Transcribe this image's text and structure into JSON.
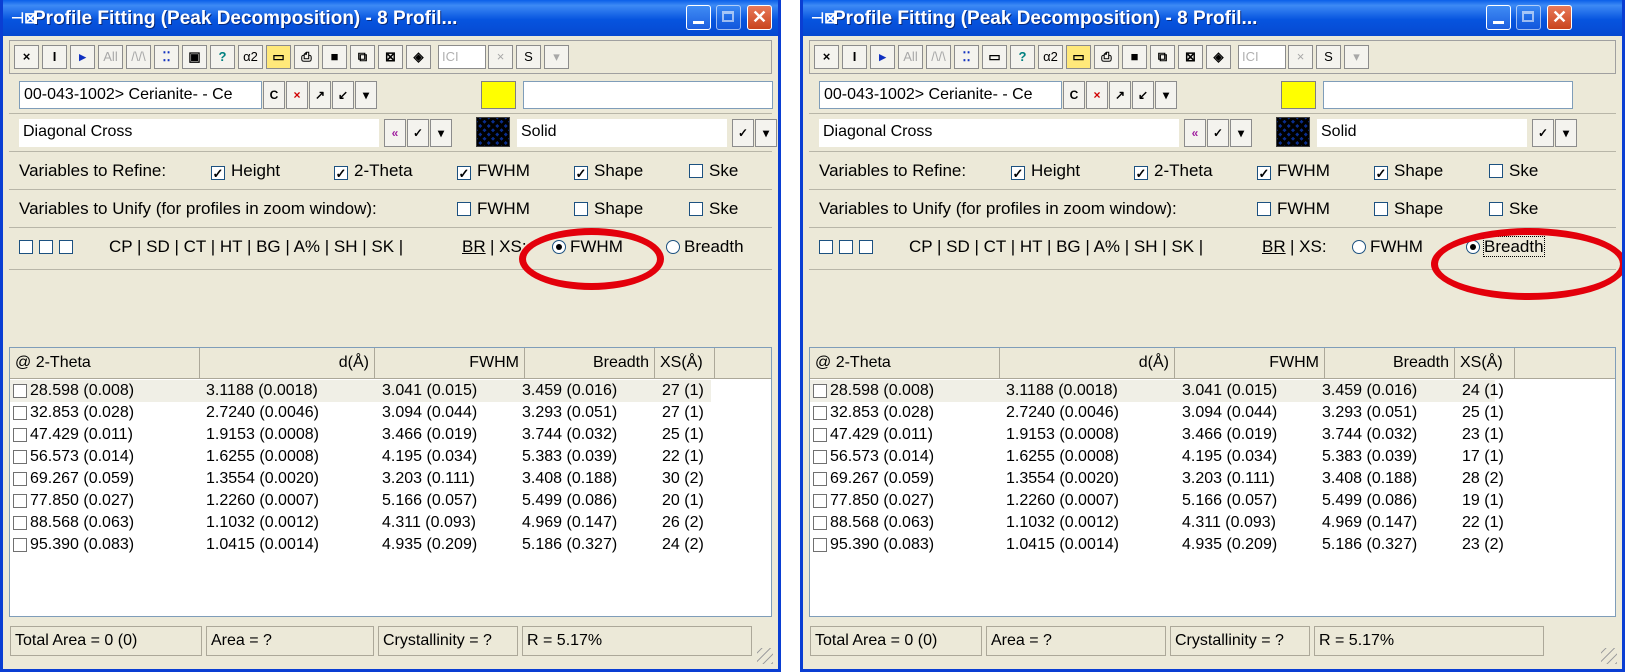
{
  "windows": [
    {
      "title": "Profile Fitting (Peak Decomposition) - 8 Profil...",
      "toolbar": {
        "close": "×",
        "i": "I",
        "play": "▸",
        "all": "All",
        "peaks": "/\\/\\",
        "dots": "⁚⁚",
        "box": "▣",
        "help": "?",
        "alpha": "α2",
        "folder": "▭",
        "print": "⎙",
        "save": "■",
        "copy": "⧉",
        "export": "⊠",
        "gem": "◈",
        "input": "ICI",
        "x": "×",
        "s": "S",
        "dd": "▾"
      },
      "phase": {
        "value": "00-043-1002> Cerianite- - Ce",
        "btn_c": "C",
        "btn_x": "×",
        "btn_up": "↗",
        "btn_down": "↙",
        "dd": "▾",
        "text2": ""
      },
      "pattern": {
        "value": "Diagonal Cross",
        "line": "Solid"
      },
      "refine": {
        "label": "Variables to Refine:",
        "items": [
          "Height",
          "2-Theta",
          "FWHM",
          "Shape",
          "Ske"
        ],
        "checked": [
          true,
          true,
          true,
          true,
          false
        ]
      },
      "unify": {
        "label": "Variables to Unify (for profiles in zoom window):",
        "items": [
          "FWHM",
          "Shape",
          "Ske"
        ],
        "checked": [
          false,
          false,
          false
        ]
      },
      "options": {
        "codes": "CP | SD | CT | HT | BG | A% | SH | SK |",
        "br": "BR",
        "xs_label": "| XS:",
        "fwhm": "FWHM",
        "breadth": "Breadth",
        "selected": "fwhm"
      },
      "table": {
        "headers": [
          "@ 2-Theta",
          "d(Å)",
          "FWHM",
          "Breadth",
          "XS(Å)"
        ],
        "rows": [
          [
            "28.598 (0.008)",
            "3.1188 (0.0018)",
            "3.041 (0.015)",
            "3.459 (0.016)",
            "27 (1)"
          ],
          [
            "32.853 (0.028)",
            "2.7240 (0.0046)",
            "3.094 (0.044)",
            "3.293 (0.051)",
            "27 (1)"
          ],
          [
            "47.429 (0.011)",
            "1.9153 (0.0008)",
            "3.466 (0.019)",
            "3.744 (0.032)",
            "25 (1)"
          ],
          [
            "56.573 (0.014)",
            "1.6255 (0.0008)",
            "4.195 (0.034)",
            "5.383 (0.039)",
            "22 (1)"
          ],
          [
            "69.267 (0.059)",
            "1.3554 (0.0020)",
            "3.203 (0.111)",
            "3.408 (0.188)",
            "30 (2)"
          ],
          [
            "77.850 (0.027)",
            "1.2260 (0.0007)",
            "5.166 (0.057)",
            "5.499 (0.086)",
            "20 (1)"
          ],
          [
            "88.568 (0.063)",
            "1.1032 (0.0012)",
            "4.311 (0.093)",
            "4.969 (0.147)",
            "26 (2)"
          ],
          [
            "95.390 (0.083)",
            "1.0415 (0.0014)",
            "4.935 (0.209)",
            "5.186 (0.327)",
            "24 (2)"
          ]
        ]
      },
      "status": {
        "total": "Total Area = 0 (0)",
        "area": "Area = ?",
        "cryst": "Crystallinity = ?",
        "r": "R = 5.17%"
      }
    },
    {
      "title": "Profile Fitting (Peak Decomposition) - 8 Profil...",
      "toolbar": {
        "close": "×",
        "i": "I",
        "play": "▸",
        "all": "All",
        "peaks": "/\\/\\",
        "dots": "⁚⁚",
        "box": "▭",
        "help": "?",
        "alpha": "α2",
        "folder": "▭",
        "print": "⎙",
        "save": "■",
        "copy": "⧉",
        "export": "⊠",
        "gem": "◈",
        "input": "ICI",
        "x": "×",
        "s": "S",
        "dd": "▾"
      },
      "phase": {
        "value": "00-043-1002> Cerianite- - Ce",
        "btn_c": "C",
        "btn_x": "×",
        "btn_up": "↗",
        "btn_down": "↙",
        "dd": "▾",
        "text2": ""
      },
      "pattern": {
        "value": "Diagonal Cross",
        "line": "Solid"
      },
      "refine": {
        "label": "Variables to Refine:",
        "items": [
          "Height",
          "2-Theta",
          "FWHM",
          "Shape",
          "Ske"
        ],
        "checked": [
          true,
          true,
          true,
          true,
          false
        ]
      },
      "unify": {
        "label": "Variables to Unify (for profiles in zoom window):",
        "items": [
          "FWHM",
          "Shape",
          "Ske"
        ],
        "checked": [
          false,
          false,
          false
        ]
      },
      "options": {
        "codes": "CP | SD | CT | HT | BG | A% | SH | SK |",
        "br": "BR",
        "xs_label": "| XS:",
        "fwhm": "FWHM",
        "breadth": "Breadth",
        "selected": "breadth"
      },
      "table": {
        "headers": [
          "@ 2-Theta",
          "d(Å)",
          "FWHM",
          "Breadth",
          "XS(Å)"
        ],
        "rows": [
          [
            "28.598 (0.008)",
            "3.1188 (0.0018)",
            "3.041 (0.015)",
            "3.459 (0.016)",
            "24 (1)"
          ],
          [
            "32.853 (0.028)",
            "2.7240 (0.0046)",
            "3.094 (0.044)",
            "3.293 (0.051)",
            "25 (1)"
          ],
          [
            "47.429 (0.011)",
            "1.9153 (0.0008)",
            "3.466 (0.019)",
            "3.744 (0.032)",
            "23 (1)"
          ],
          [
            "56.573 (0.014)",
            "1.6255 (0.0008)",
            "4.195 (0.034)",
            "5.383 (0.039)",
            "17 (1)"
          ],
          [
            "69.267 (0.059)",
            "1.3554 (0.0020)",
            "3.203 (0.111)",
            "3.408 (0.188)",
            "28 (2)"
          ],
          [
            "77.850 (0.027)",
            "1.2260 (0.0007)",
            "5.166 (0.057)",
            "5.499 (0.086)",
            "19 (1)"
          ],
          [
            "88.568 (0.063)",
            "1.1032 (0.0012)",
            "4.311 (0.093)",
            "4.969 (0.147)",
            "22 (1)"
          ],
          [
            "95.390 (0.083)",
            "1.0415 (0.0014)",
            "4.935 (0.209)",
            "5.186 (0.327)",
            "23 (2)"
          ]
        ]
      },
      "status": {
        "total": "Total Area = 0 (0)",
        "area": "Area = ?",
        "cryst": "Crystallinity = ?",
        "r": "R = 5.17%"
      }
    }
  ],
  "colors": {
    "highlight_ellipse": "#e3000b",
    "titlebar": "#0654df",
    "phase_swatch": "#ffff00"
  }
}
